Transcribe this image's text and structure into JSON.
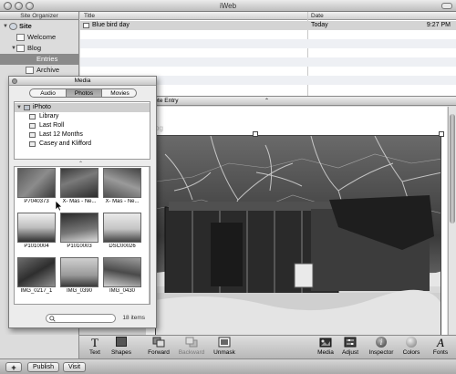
{
  "window": {
    "title": "iWeb"
  },
  "sidebar": {
    "header": "Site Organizer",
    "items": [
      {
        "label": "Site"
      },
      {
        "label": "Welcome"
      },
      {
        "label": "Blog"
      },
      {
        "label": "Entries",
        "selected": true
      },
      {
        "label": "Archive"
      }
    ]
  },
  "entries_list": {
    "columns": [
      "Title",
      "Date"
    ],
    "rows": [
      {
        "title": "Blue bird day",
        "date": "Today",
        "time": "9:27 PM"
      }
    ]
  },
  "editor": {
    "bar_label": "lete Entry",
    "page_fragment": "og"
  },
  "media": {
    "title": "Media",
    "tabs": [
      "Audio",
      "Photos",
      "Movies"
    ],
    "selected_tab": "Photos",
    "sources": [
      {
        "label": "iPhoto",
        "selected": true
      },
      {
        "label": "Library"
      },
      {
        "label": "Last Roll"
      },
      {
        "label": "Last 12 Months"
      },
      {
        "label": "Casey and Klifford"
      }
    ],
    "photos": [
      {
        "caption": "P7040373"
      },
      {
        "caption": "X- Mas - Ne..."
      },
      {
        "caption": "X- Mas - Ne..."
      },
      {
        "caption": "P1010004"
      },
      {
        "caption": "P1010003"
      },
      {
        "caption": "DSC00026"
      },
      {
        "caption": "IMG_0217_1"
      },
      {
        "caption": "IMG_0390"
      },
      {
        "caption": "IMG_0430"
      }
    ],
    "item_count": "18 items"
  },
  "toolbar": {
    "items": [
      {
        "label": "Text",
        "icon": "text-icon"
      },
      {
        "label": "Shapes",
        "icon": "shapes-icon"
      },
      {
        "label": "Forward",
        "icon": "forward-icon"
      },
      {
        "label": "Backward",
        "icon": "backward-icon",
        "disabled": true
      },
      {
        "label": "Unmask",
        "icon": "unmask-icon"
      },
      {
        "label": "Media",
        "icon": "media-icon"
      },
      {
        "label": "Adjust",
        "icon": "adjust-icon"
      },
      {
        "label": "Inspector",
        "icon": "inspector-icon"
      },
      {
        "label": "Colors",
        "icon": "colors-icon"
      },
      {
        "label": "Fonts",
        "icon": "fonts-icon"
      }
    ]
  },
  "bottombar": {
    "add_label": "+",
    "publish_label": "Publish",
    "visit_label": "Visit"
  }
}
